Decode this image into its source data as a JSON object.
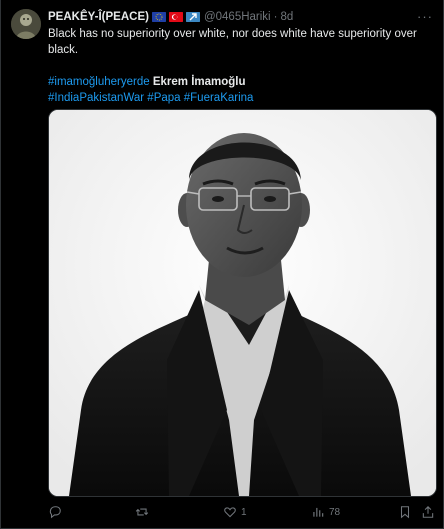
{
  "tweet": {
    "author": {
      "display_name": "PEAKÊY-Î(PEACE)",
      "handle": "@0465Hariki",
      "time": "8d",
      "separator": "·"
    },
    "text_line": "Black has no superiority over white, nor does white have superiority over black.",
    "hashtag_1": "#imamoğluheryerde",
    "mention": "Ekrem İmamoğlu",
    "hashtag_2": "#IndiaPakistanWar",
    "hashtag_3": "#Papa",
    "hashtag_4": "#FueraKarina",
    "more_label": "···"
  },
  "actions": {
    "reply_count": "",
    "retweet_count": "",
    "like_count": "1",
    "views_count": "78"
  },
  "colors": {
    "background": "#000000",
    "text": "#e7e9ea",
    "muted": "#71767b",
    "link": "#1d9bf0",
    "border": "#2f3336"
  },
  "icons": {
    "flag_1": "eu-flag-icon",
    "flag_2": "turkey-flag-icon",
    "flag_3": "arrow-square-icon"
  }
}
